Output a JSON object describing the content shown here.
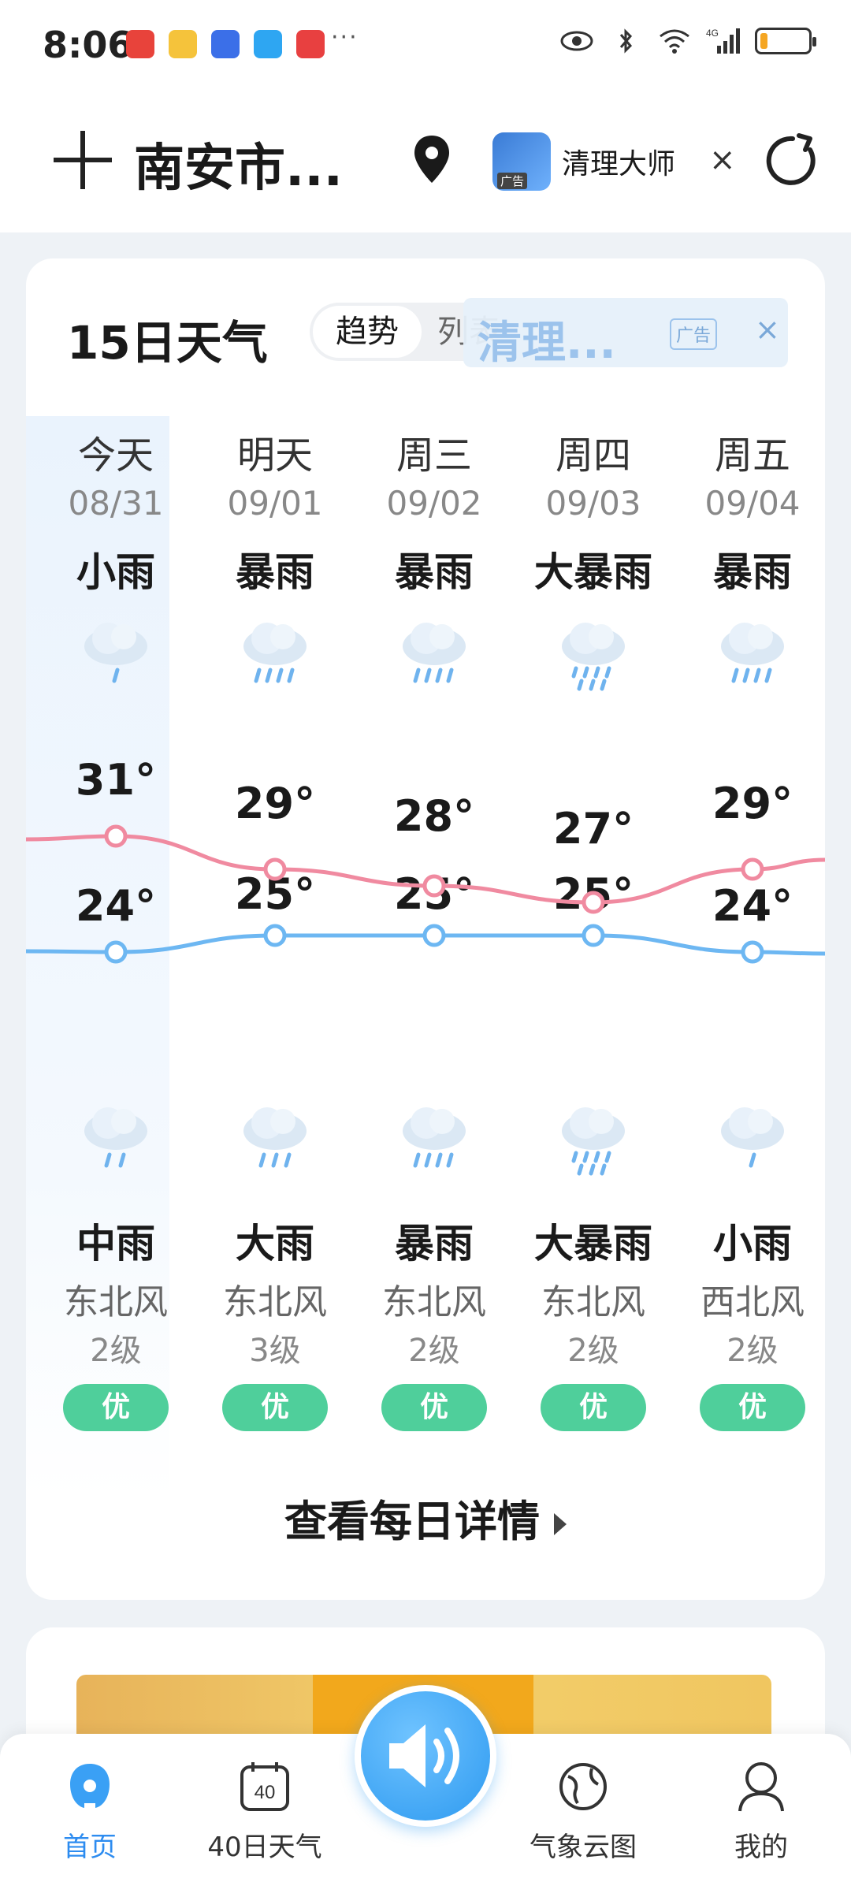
{
  "status_bar": {
    "time": "8:06",
    "app_icons": [
      "huawei-app-icon",
      "weibo-icon",
      "shield-app-icon",
      "message-app-icon",
      "book-app-icon"
    ],
    "more": "···",
    "right_icons": [
      "eye-icon",
      "bluetooth-icon",
      "wifi-icon",
      "4g-signal-icon",
      "battery-icon"
    ],
    "network": "4G",
    "battery_level": 0.15
  },
  "header": {
    "city": "南安市...",
    "ad_title": "清理大师",
    "ad_tag": "广告",
    "ad_close": "×"
  },
  "forecast_card": {
    "title": "15日天气",
    "toggle_on": "趋势",
    "toggle_off": "列表",
    "ad_text": "清理...",
    "ad_tag": "广告",
    "ad_close": "×",
    "detail_link": "查看每日详情",
    "days": [
      {
        "day": "今天",
        "date": "08/31",
        "weather_day": "小雨",
        "high": "31°",
        "low": "24°",
        "weather_night": "中雨",
        "wind_dir": "东北风",
        "wind_level": "2级",
        "aqi": "优"
      },
      {
        "day": "明天",
        "date": "09/01",
        "weather_day": "暴雨",
        "high": "29°",
        "low": "25°",
        "weather_night": "大雨",
        "wind_dir": "东北风",
        "wind_level": "3级",
        "aqi": "优"
      },
      {
        "day": "周三",
        "date": "09/02",
        "weather_day": "暴雨",
        "high": "28°",
        "low": "25°",
        "weather_night": "暴雨",
        "wind_dir": "东北风",
        "wind_level": "2级",
        "aqi": "优"
      },
      {
        "day": "周四",
        "date": "09/03",
        "weather_day": "大暴雨",
        "high": "27°",
        "low": "25°",
        "weather_night": "大暴雨",
        "wind_dir": "东北风",
        "wind_level": "2级",
        "aqi": "优"
      },
      {
        "day": "周五",
        "date": "09/04",
        "weather_day": "暴雨",
        "high": "29°",
        "low": "24°",
        "weather_night": "小雨",
        "wind_dir": "西北风",
        "wind_level": "2级",
        "aqi": "优"
      }
    ]
  },
  "chart_data": {
    "type": "line",
    "categories": [
      "08/31",
      "09/01",
      "09/02",
      "09/03",
      "09/04"
    ],
    "series": [
      {
        "values": [
          31,
          29,
          28,
          27,
          29
        ],
        "color": "#f08aa0"
      },
      {
        "values": [
          24,
          25,
          25,
          25,
          24
        ],
        "color": "#6db7f2"
      }
    ]
  },
  "bottom_nav": {
    "items": [
      {
        "label": "首页",
        "icon": "home-icon",
        "active": true
      },
      {
        "label": "40日天气",
        "icon": "calendar-40-icon",
        "active": false
      },
      {
        "label": "气象云图",
        "icon": "globe-icon",
        "active": false
      },
      {
        "label": "我的",
        "icon": "profile-icon",
        "active": false
      }
    ],
    "center_icon": "speaker-icon"
  },
  "colors": {
    "accent": "#2d8cf0",
    "high_line": "#f08aa0",
    "low_line": "#6db7f2",
    "aqi_good": "#4fcf9b"
  }
}
